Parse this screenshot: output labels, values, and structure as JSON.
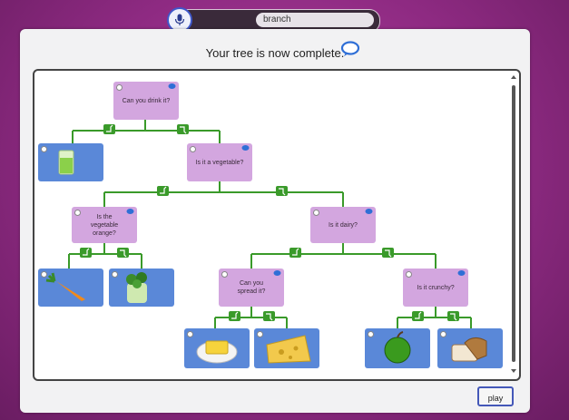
{
  "search": {
    "value": "branch"
  },
  "heading": "Your tree is now complete.",
  "questions": {
    "q1": "Can you drink it?",
    "q2": "Is it a vegetable?",
    "q3": "Is the vegetable orange?",
    "q4": "Is it dairy?",
    "q5": "Can you spread it?",
    "q6": "Is it crunchy?"
  },
  "answers": [
    "juice",
    "carrot",
    "celery",
    "butter",
    "cheese",
    "apple",
    "bread"
  ],
  "play_label": "play",
  "colors": {
    "question": "#d3a6df",
    "answer": "#5a88d8",
    "branch": "#3a9a2a",
    "accent": "#3f57c9"
  }
}
